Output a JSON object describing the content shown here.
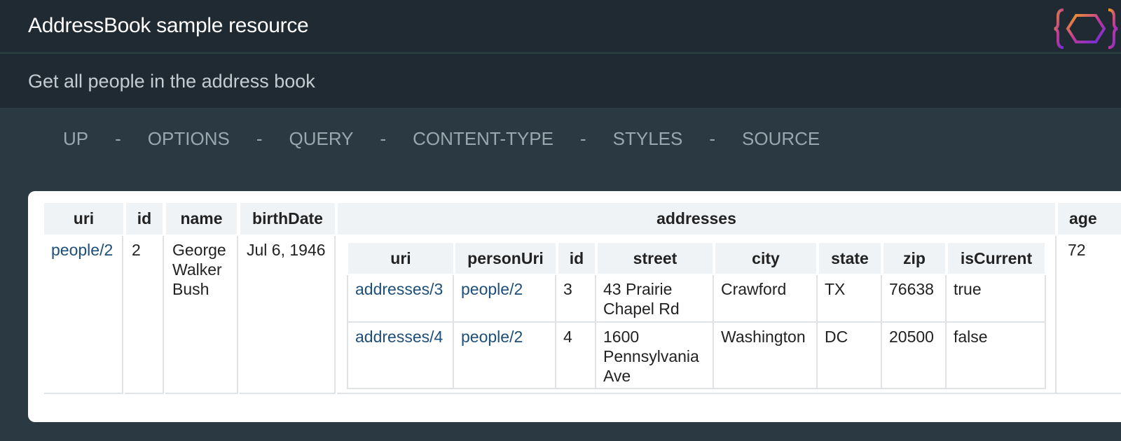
{
  "header": {
    "title": "AddressBook sample resource"
  },
  "subheader": {
    "text": "Get all people in the address book"
  },
  "nav": {
    "items": [
      "UP",
      "OPTIONS",
      "QUERY",
      "CONTENT-TYPE",
      "STYLES",
      "SOURCE"
    ],
    "separator": "-"
  },
  "table": {
    "columns": [
      "uri",
      "id",
      "name",
      "birthDate",
      "addresses",
      "age"
    ],
    "rows": [
      {
        "uri": "people/2",
        "id": "2",
        "name": "George Walker Bush",
        "birthDate": "Jul 6, 1946",
        "age": "72",
        "addresses": {
          "columns": [
            "uri",
            "personUri",
            "id",
            "street",
            "city",
            "state",
            "zip",
            "isCurrent"
          ],
          "rows": [
            [
              "addresses/3",
              "people/2",
              "3",
              "43 Prairie Chapel Rd",
              "Crawford",
              "TX",
              "76638",
              "true"
            ],
            [
              "addresses/4",
              "people/2",
              "4",
              "1600 Pennsylvania Ave",
              "Washington",
              "DC",
              "20500",
              "false"
            ]
          ]
        }
      }
    ]
  },
  "colors": {
    "background": "#2b3a42",
    "header": "#1f2a33",
    "link": "#1d4f7a",
    "nav": "#9aa7af"
  }
}
